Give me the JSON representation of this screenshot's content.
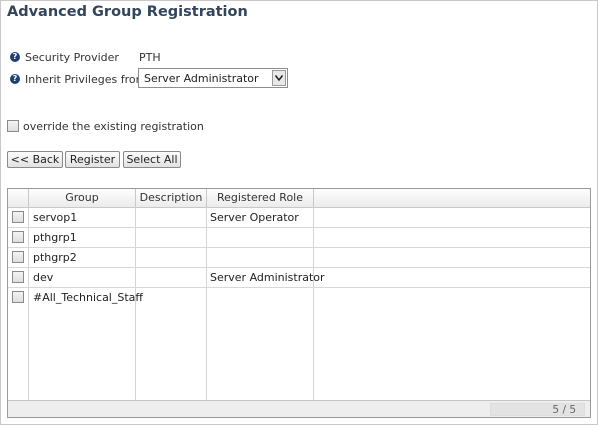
{
  "page": {
    "title": "Advanced Group Registration"
  },
  "form": {
    "security_provider_label": "Security Provider",
    "security_provider_value": "PTH",
    "inherit_label": "Inherit Privileges from",
    "inherit_value": "Server Administrator",
    "override_label": "override the existing registration",
    "override_checked": false
  },
  "buttons": {
    "back": "<< Back",
    "register": "Register",
    "select_all": "Select All"
  },
  "table": {
    "columns": [
      "Group",
      "Description",
      "Registered Role"
    ],
    "rows": [
      {
        "group": "servop1",
        "description": "",
        "role": "Server Operator"
      },
      {
        "group": "pthgrp1",
        "description": "",
        "role": ""
      },
      {
        "group": "pthgrp2",
        "description": "",
        "role": ""
      },
      {
        "group": "dev",
        "description": "",
        "role": "Server Administrator"
      },
      {
        "group": "#All_Technical_Staff",
        "description": "",
        "role": ""
      }
    ],
    "pager": "5 / 5"
  },
  "icons": {
    "help": "question-circle-icon",
    "dropdown": "chevron-down-icon"
  },
  "colors": {
    "title": "#33455c",
    "help_icon": "#1f3f78"
  }
}
